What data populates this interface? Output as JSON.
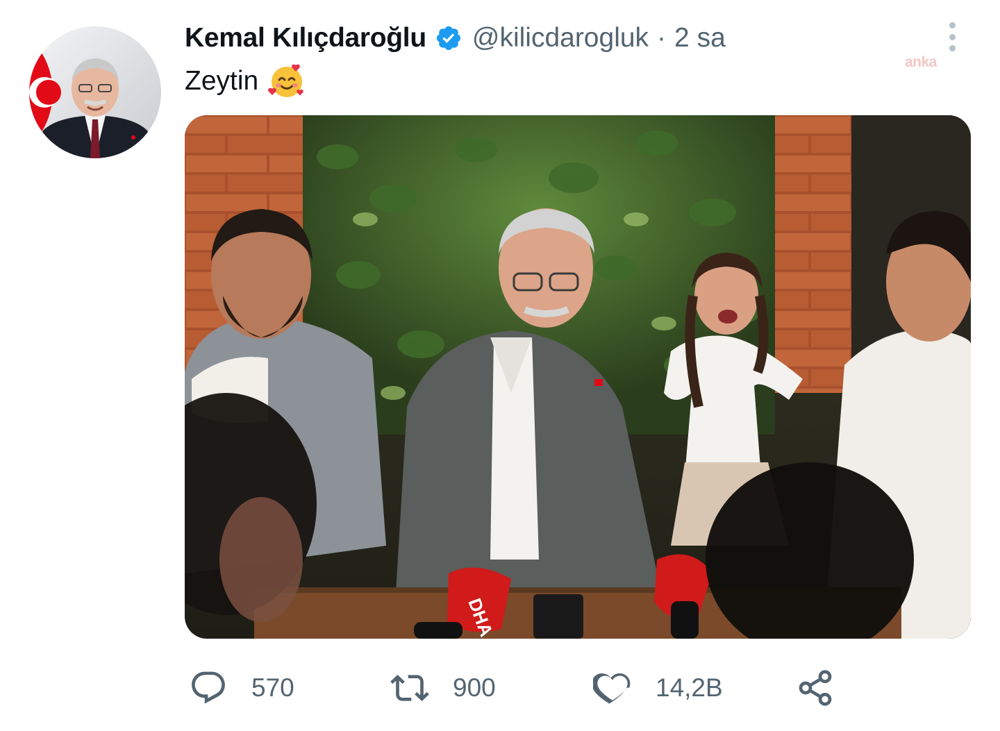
{
  "tweet": {
    "author": {
      "display_name": "Kemal Kılıçdaroğlu",
      "handle": "@kilicdarogluk",
      "verified": true,
      "avatar_icon": "profile-photo"
    },
    "separator": "·",
    "time": "2 sa",
    "text": "Zeytin",
    "emoji_icon": "smiling-face-with-hearts",
    "watermark": "anka",
    "media": {
      "type": "photo",
      "microphone_labels": [
        "DHA"
      ]
    },
    "actions": {
      "reply": {
        "icon": "reply-icon",
        "count": "570"
      },
      "retweet": {
        "icon": "retweet-icon",
        "count": "900"
      },
      "like": {
        "icon": "heart-icon",
        "count": "14,2B"
      },
      "share": {
        "icon": "share-icon"
      }
    },
    "colors": {
      "verified": "#1d9bf0",
      "text_primary": "#0f1419",
      "text_secondary": "#536471"
    }
  }
}
